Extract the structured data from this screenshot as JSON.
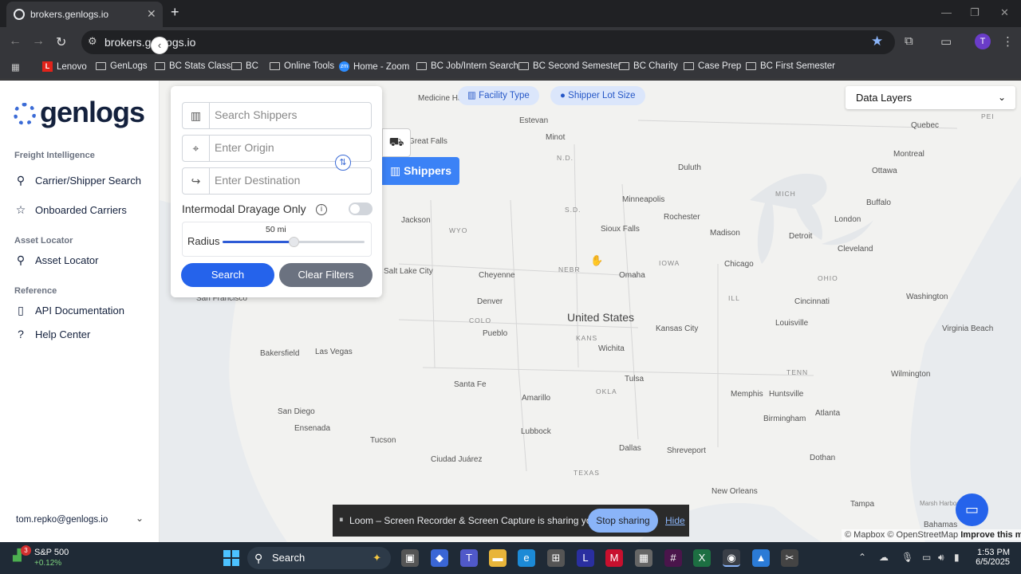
{
  "browser": {
    "tab_title": "brokers.genlogs.io",
    "url": "brokers.genlogs.io",
    "profile_initial": "T",
    "bookmarks": [
      {
        "label": "Lenovo",
        "icon": "lenovo-icon"
      },
      {
        "label": "GenLogs",
        "icon": "folder-icon"
      },
      {
        "label": "BC Stats Class",
        "icon": "folder-icon"
      },
      {
        "label": "BC",
        "icon": "folder-icon"
      },
      {
        "label": "Online Tools",
        "icon": "folder-icon"
      },
      {
        "label": "Home - Zoom",
        "icon": "zoom-icon"
      },
      {
        "label": "BC Job/Intern Search",
        "icon": "folder-icon"
      },
      {
        "label": "BC Second Semester",
        "icon": "folder-icon"
      },
      {
        "label": "BC Charity",
        "icon": "folder-icon"
      },
      {
        "label": "Case Prep",
        "icon": "folder-icon"
      },
      {
        "label": "BC First Semester",
        "icon": "folder-icon"
      }
    ]
  },
  "sidebar": {
    "logo": "genlogs",
    "sections": [
      {
        "title": "Freight Intelligence",
        "items": [
          {
            "label": "Carrier/Shipper Search",
            "icon": "search-icon"
          },
          {
            "label": "Onboarded Carriers",
            "icon": "star-icon"
          }
        ]
      },
      {
        "title": "Asset Locator",
        "items": [
          {
            "label": "Asset Locator",
            "icon": "search-icon"
          }
        ]
      },
      {
        "title": "Reference",
        "items": [
          {
            "label": "API Documentation",
            "icon": "book-icon"
          },
          {
            "label": "Help Center",
            "icon": "help-icon"
          }
        ]
      }
    ],
    "user_email": "tom.repko@genlogs.io"
  },
  "search_panel": {
    "shippers_placeholder": "Search Shippers",
    "origin_placeholder": "Enter Origin",
    "destination_placeholder": "Enter Destination",
    "drayage_label": "Intermodal Drayage Only",
    "drayage_enabled": false,
    "radius_label": "Radius",
    "radius_value": "50 mi",
    "radius_fraction": 0.5,
    "search_label": "Search",
    "clear_label": "Clear Filters"
  },
  "map": {
    "shippers_tab": "Shippers",
    "chips": [
      "Facility Type",
      "Shipper Lot Size"
    ],
    "data_layers": "Data Layers",
    "country_label": "United States",
    "attribution": {
      "mapbox": "© Mapbox",
      "osm": "© OpenStreetMap",
      "improve": "Improve this map"
    },
    "cities": [
      "Medicine Hat",
      "Estevan",
      "Minot",
      "Duluth",
      "Quebec",
      "Montreal",
      "Ottawa",
      "Great Falls",
      "Minneapolis",
      "Rochester",
      "London",
      "Buffalo",
      "Jackson",
      "Sioux Falls",
      "Madison",
      "Detroit",
      "Cleveland",
      "Chicago",
      "Cheyenne",
      "Omaha",
      "Salt Lake City",
      "San Francisco",
      "Denver",
      "Kansas City",
      "Cincinnati",
      "Washington",
      "Pueblo",
      "Wichita",
      "Louisville",
      "Virginia Beach",
      "Bakersfield",
      "Las Vegas",
      "Santa Fe",
      "Tulsa",
      "Wilmington",
      "Amarillo",
      "Memphis",
      "Huntsville",
      "San Diego",
      "Ensenada",
      "Birmingham",
      "Atlanta",
      "Tucson",
      "Lubbock",
      "Dallas",
      "Shreveport",
      "Ciudad Juárez",
      "Dothan",
      "New Orleans",
      "Tampa",
      "Bahamas",
      "Marsh Harbour"
    ],
    "states": [
      "N.D.",
      "S.D.",
      "MICH",
      "WYO",
      "NEBR",
      "IOWA",
      "OHIO",
      "COLO",
      "ILL",
      "KANS",
      "TENN",
      "OKLA",
      "TEXAS",
      "PEI"
    ]
  },
  "loom": {
    "message": "Loom – Screen Recorder & Screen Capture is sharing your screen.",
    "stop": "Stop sharing",
    "hide": "Hide"
  },
  "taskbar": {
    "stock_name": "S&P 500",
    "stock_change": "+0.12%",
    "stock_badge": "3",
    "search": "Search",
    "time": "1:53 PM",
    "date": "6/5/2025"
  }
}
